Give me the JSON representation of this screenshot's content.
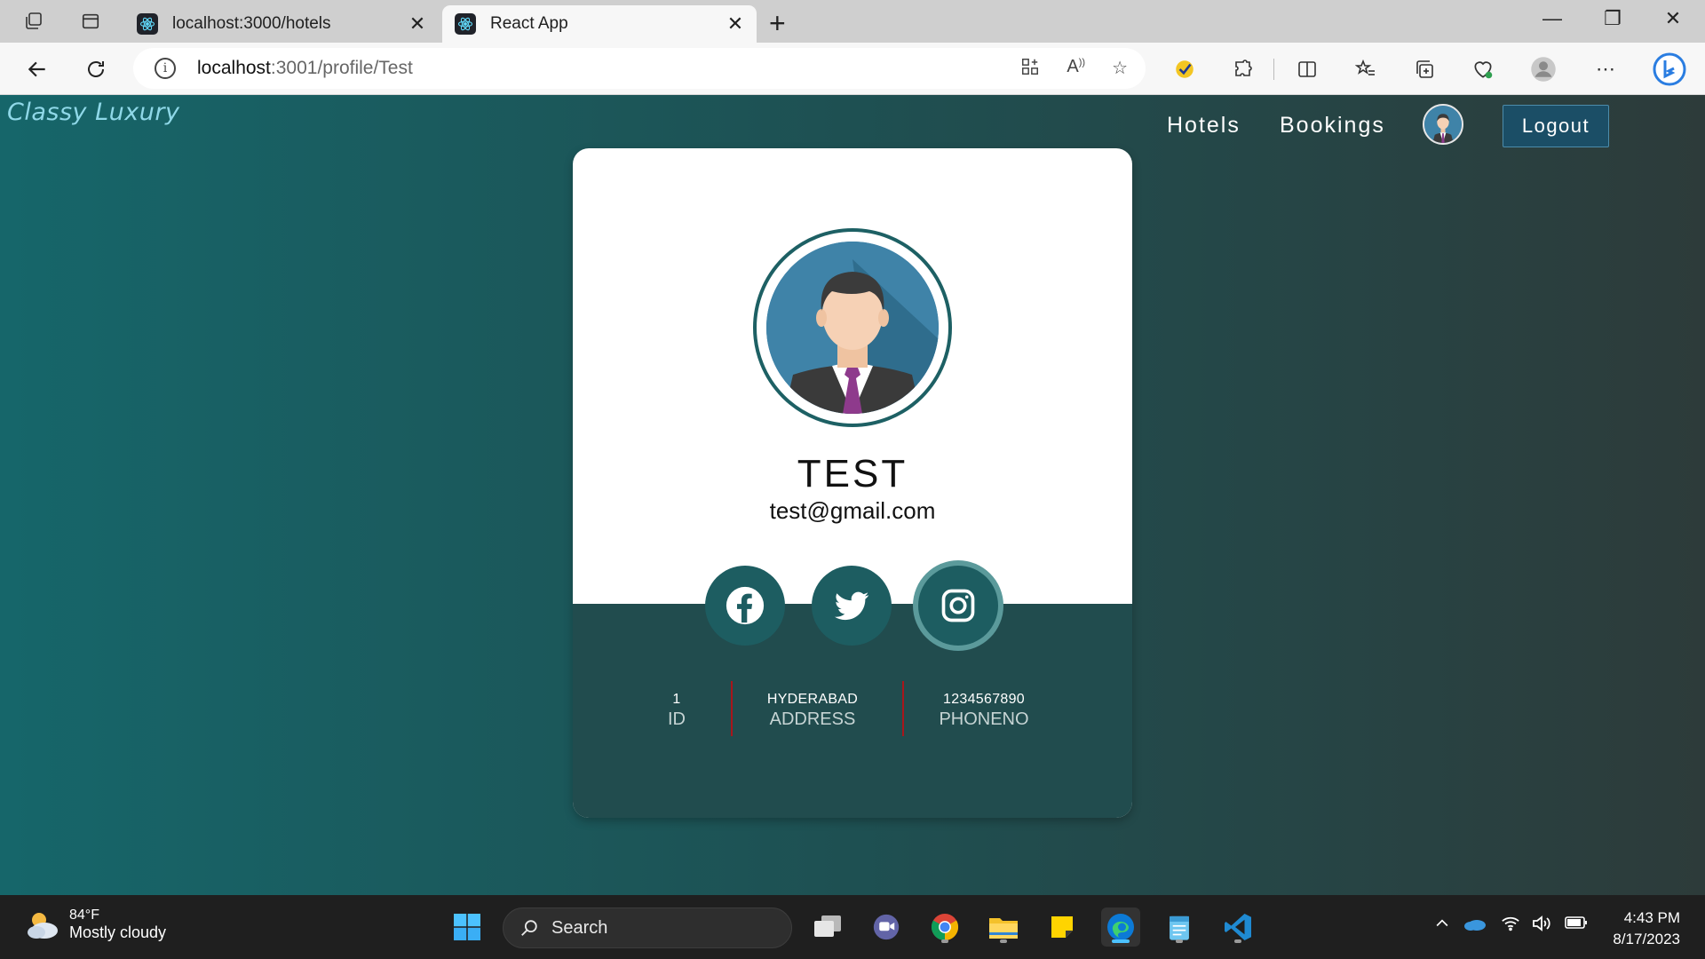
{
  "browser": {
    "tabs": [
      {
        "title": "localhost:3000/hotels",
        "active": false
      },
      {
        "title": "React App",
        "active": true
      }
    ],
    "url_host": "localhost",
    "url_path": ":3001/profile/Test"
  },
  "app": {
    "brand": "Classy Luxury",
    "nav": [
      "Hotels",
      "Bookings"
    ],
    "logout_label": "Logout"
  },
  "profile": {
    "name": "TEST",
    "email": "test@gmail.com",
    "social": [
      "facebook",
      "twitter",
      "instagram"
    ],
    "stats": [
      {
        "value": "1",
        "label": "ID"
      },
      {
        "value": "HYDERABAD",
        "label": "ADDRESS"
      },
      {
        "value": "1234567890",
        "label": "PHONENO"
      }
    ]
  },
  "taskbar": {
    "weather_temp": "84°F",
    "weather_desc": "Mostly cloudy",
    "search_placeholder": "Search",
    "time": "4:43 PM",
    "date": "8/17/2023"
  },
  "colors": {
    "accent": "#1d6064",
    "card_bottom": "#214c4e",
    "divider": "#a8161b"
  }
}
